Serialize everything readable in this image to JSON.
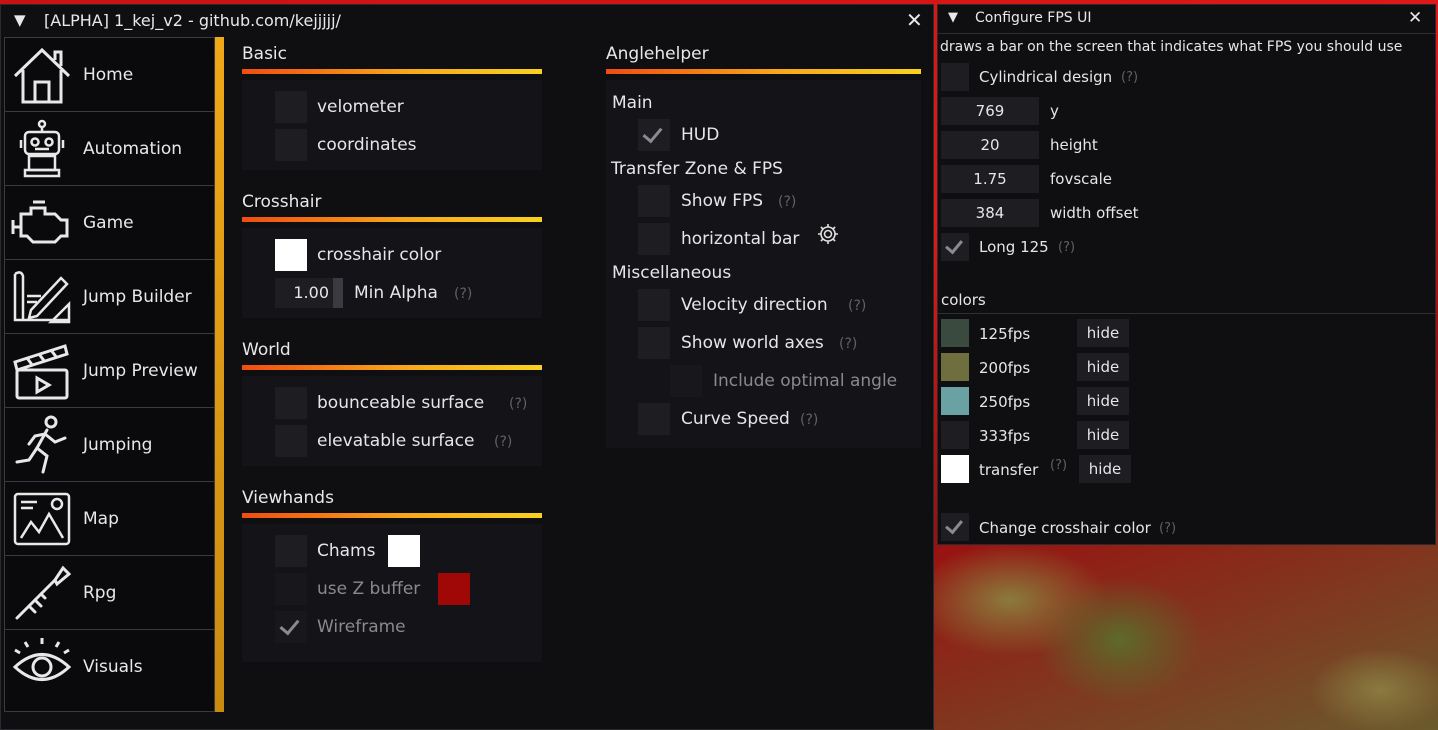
{
  "main_window": {
    "title": "[ALPHA] 1_kej_v2 - github.com/kejjjjj/",
    "collapse_glyph": "▼",
    "close_glyph": "✕"
  },
  "sidebar": {
    "items": [
      {
        "label": "Home",
        "icon": "home-icon"
      },
      {
        "label": "Automation",
        "icon": "robot-icon"
      },
      {
        "label": "Game",
        "icon": "engine-icon"
      },
      {
        "label": "Jump Builder",
        "icon": "blueprint-pencil-icon"
      },
      {
        "label": "Jump Preview",
        "icon": "clapperboard-icon"
      },
      {
        "label": "Jumping",
        "icon": "running-person-icon"
      },
      {
        "label": "Map",
        "icon": "map-icon"
      },
      {
        "label": "Rpg",
        "icon": "rocket-launcher-icon"
      },
      {
        "label": "Visuals",
        "icon": "eye-icon"
      }
    ],
    "accent_color": "#f0a818"
  },
  "basic": {
    "heading": "Basic",
    "velometer": "velometer",
    "coordinates": "coordinates"
  },
  "crosshair": {
    "heading": "Crosshair",
    "color_label": "crosshair color",
    "color": "#ffffff",
    "alpha_value": "1.00",
    "alpha_label": "Min Alpha",
    "help": "(?)"
  },
  "world": {
    "heading": "World",
    "bounceable": "bounceable surface",
    "elevatable": "elevatable surface",
    "help": "(?)"
  },
  "viewhands": {
    "heading": "Viewhands",
    "chams": "Chams",
    "chams_color": "#ffffff",
    "zbuffer": "use Z buffer",
    "zbuffer_color": "#a00808",
    "wireframe": "Wireframe"
  },
  "anglehelper": {
    "heading": "Anglehelper",
    "main": "Main",
    "hud": "HUD",
    "transfer_zone": "Transfer Zone & FPS",
    "show_fps": "Show FPS",
    "horizontal_bar": "horizontal bar",
    "misc": "Miscellaneous",
    "velocity_direction": "Velocity direction",
    "show_world_axes": "Show world axes",
    "include_optimal_angle": "Include optimal angle",
    "curve_speed": "Curve Speed",
    "help": "(?)",
    "gear_icon": "gear-icon"
  },
  "fps_window": {
    "title": "Configure FPS UI",
    "description": "draws a bar on the screen that indicates what FPS you should use",
    "cylindrical": "Cylindrical design",
    "y_value": "769",
    "y_label": "y",
    "height_value": "20",
    "height_label": "height",
    "fovscale_value": "1.75",
    "fovscale_label": "fovscale",
    "width_offset_value": "384",
    "width_offset_label": "width offset",
    "long125": "Long 125",
    "colors_heading": "colors",
    "colors": [
      {
        "label": "125fps",
        "color": "#3a4a3e",
        "button": "hide"
      },
      {
        "label": "200fps",
        "color": "#6e6e3e",
        "button": "hide"
      },
      {
        "label": "250fps",
        "color": "#6aa2a4",
        "button": "hide"
      },
      {
        "label": "333fps",
        "color": "#1d1d22",
        "button": "hide"
      },
      {
        "label": "transfer",
        "color": "#ffffff",
        "button": "hide"
      }
    ],
    "change_crosshair": "Change crosshair color",
    "help": "(?)"
  }
}
